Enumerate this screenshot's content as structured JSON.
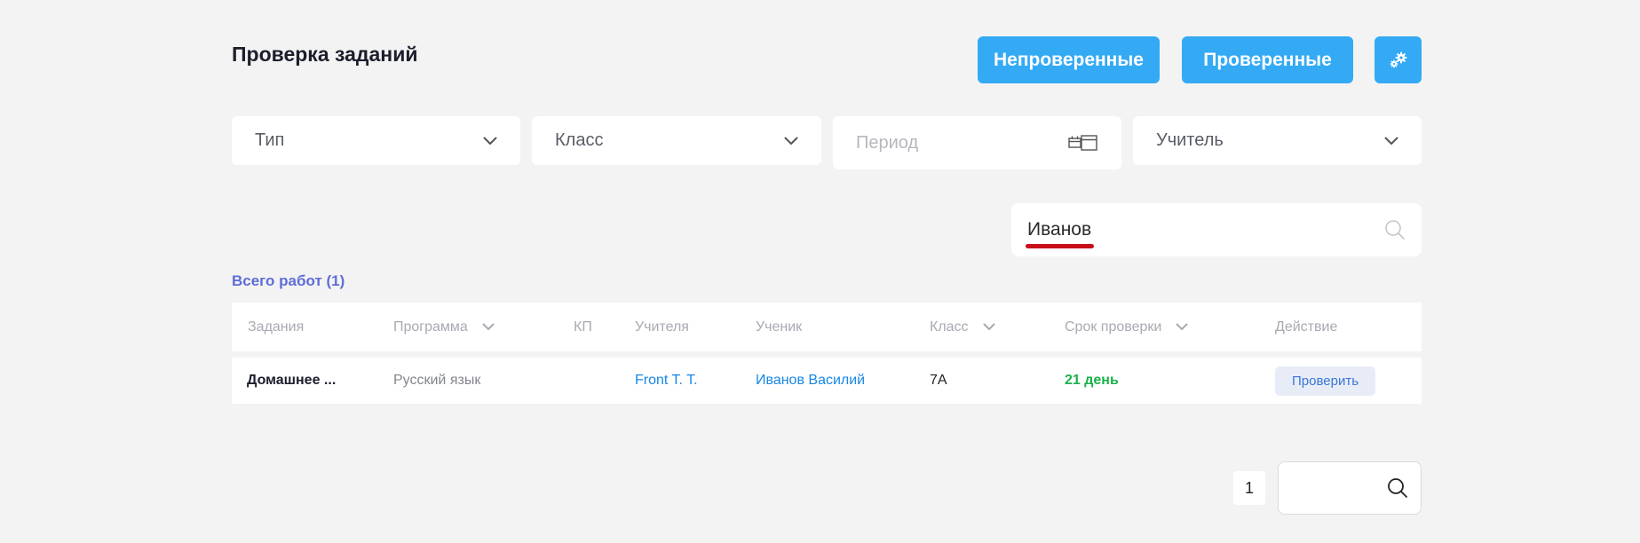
{
  "header": {
    "title": "Проверка заданий",
    "unchecked_label": "Непроверенные",
    "checked_label": "Проверенные",
    "settings_icon": "gears-icon"
  },
  "filters": {
    "type_label": "Тип",
    "class_label": "Класс",
    "period_placeholder": "Период",
    "teacher_label": "Учитель"
  },
  "search": {
    "value": "Иванов"
  },
  "summary": {
    "total_label": "Всего работ (1)"
  },
  "table": {
    "columns": [
      "Задания",
      "Программа",
      "КП",
      "Учителя",
      "Ученик",
      "Класс",
      "Срок проверки",
      "Действие"
    ],
    "rows": [
      {
        "task": "Домашнее ...",
        "program": "Русский язык",
        "kp": "",
        "teacher": "Front T. T.",
        "student": "Иванов Василий",
        "class": "7А",
        "deadline": "21 день",
        "action": "Проверить"
      }
    ]
  },
  "pagination": {
    "current_page": "1"
  },
  "colors": {
    "accent": "#34aaf5",
    "link": "#1787e6",
    "deadline_ok": "#1bb24a",
    "total_text": "#5f6dda",
    "spellcheck_underline": "#c8101a"
  }
}
